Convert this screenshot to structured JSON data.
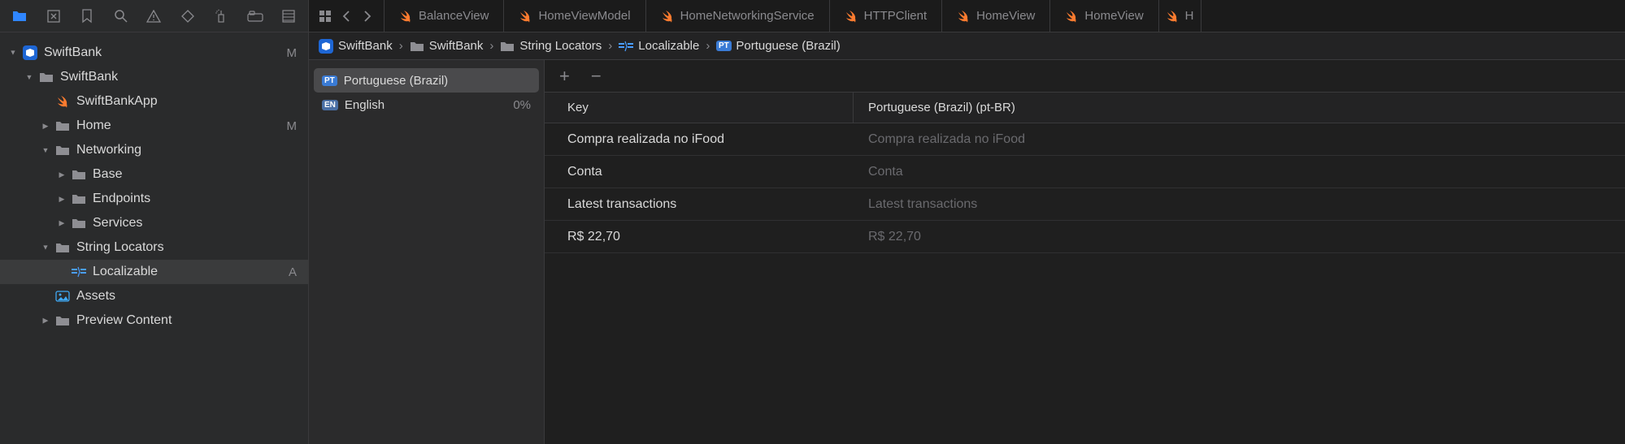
{
  "toolbar_icons": [
    "folder",
    "box",
    "bookmark",
    "search",
    "warning",
    "diamond",
    "spray",
    "tab",
    "sidebar"
  ],
  "tree": [
    {
      "indent": 0,
      "chev": "▾",
      "icon": "proj",
      "label": "SwiftBank",
      "badge": "M"
    },
    {
      "indent": 1,
      "chev": "▾",
      "icon": "folder",
      "label": "SwiftBank",
      "badge": ""
    },
    {
      "indent": 2,
      "chev": "",
      "icon": "swift",
      "label": "SwiftBankApp",
      "badge": ""
    },
    {
      "indent": 2,
      "chev": "▸",
      "icon": "folder",
      "label": "Home",
      "badge": "M"
    },
    {
      "indent": 2,
      "chev": "▾",
      "icon": "folder",
      "label": "Networking",
      "badge": ""
    },
    {
      "indent": 3,
      "chev": "▸",
      "icon": "folder",
      "label": "Base",
      "badge": ""
    },
    {
      "indent": 3,
      "chev": "▸",
      "icon": "folder",
      "label": "Endpoints",
      "badge": ""
    },
    {
      "indent": 3,
      "chev": "▸",
      "icon": "folder",
      "label": "Services",
      "badge": ""
    },
    {
      "indent": 2,
      "chev": "▾",
      "icon": "folder",
      "label": "String Locators",
      "badge": ""
    },
    {
      "indent": 3,
      "chev": "",
      "icon": "loc",
      "label": "Localizable",
      "badge": "A",
      "sel": true
    },
    {
      "indent": 2,
      "chev": "",
      "icon": "assets",
      "label": "Assets",
      "badge": ""
    },
    {
      "indent": 2,
      "chev": "▸",
      "icon": "folder",
      "label": "Preview Content",
      "badge": ""
    }
  ],
  "tabs": [
    {
      "label": "BalanceView"
    },
    {
      "label": "HomeViewModel"
    },
    {
      "label": "HomeNetworkingService"
    },
    {
      "label": "HTTPClient"
    },
    {
      "label": "HomeView"
    },
    {
      "label": "HomeView"
    },
    {
      "label": "H"
    }
  ],
  "breadcrumb": [
    {
      "icon": "proj",
      "label": "SwiftBank"
    },
    {
      "icon": "folder",
      "label": "SwiftBank"
    },
    {
      "icon": "folder",
      "label": "String Locators"
    },
    {
      "icon": "loc",
      "label": "Localizable"
    },
    {
      "icon": "lang",
      "label": "Portuguese (Brazil)"
    }
  ],
  "locales": [
    {
      "code": "PT",
      "label": "Portuguese (Brazil)",
      "pct": "",
      "sel": true
    },
    {
      "code": "EN",
      "label": "English",
      "pct": "0%",
      "sel": false
    }
  ],
  "table": {
    "head_key": "Key",
    "head_val": "Portuguese (Brazil) (pt-BR)",
    "rows": [
      {
        "k": "Compra realizada no iFood",
        "v": "Compra realizada no iFood"
      },
      {
        "k": "Conta",
        "v": "Conta"
      },
      {
        "k": "Latest transactions",
        "v": "Latest transactions"
      },
      {
        "k": "R$ 22,70",
        "v": "R$ 22,70"
      }
    ]
  },
  "plus": "+",
  "minus": "−"
}
